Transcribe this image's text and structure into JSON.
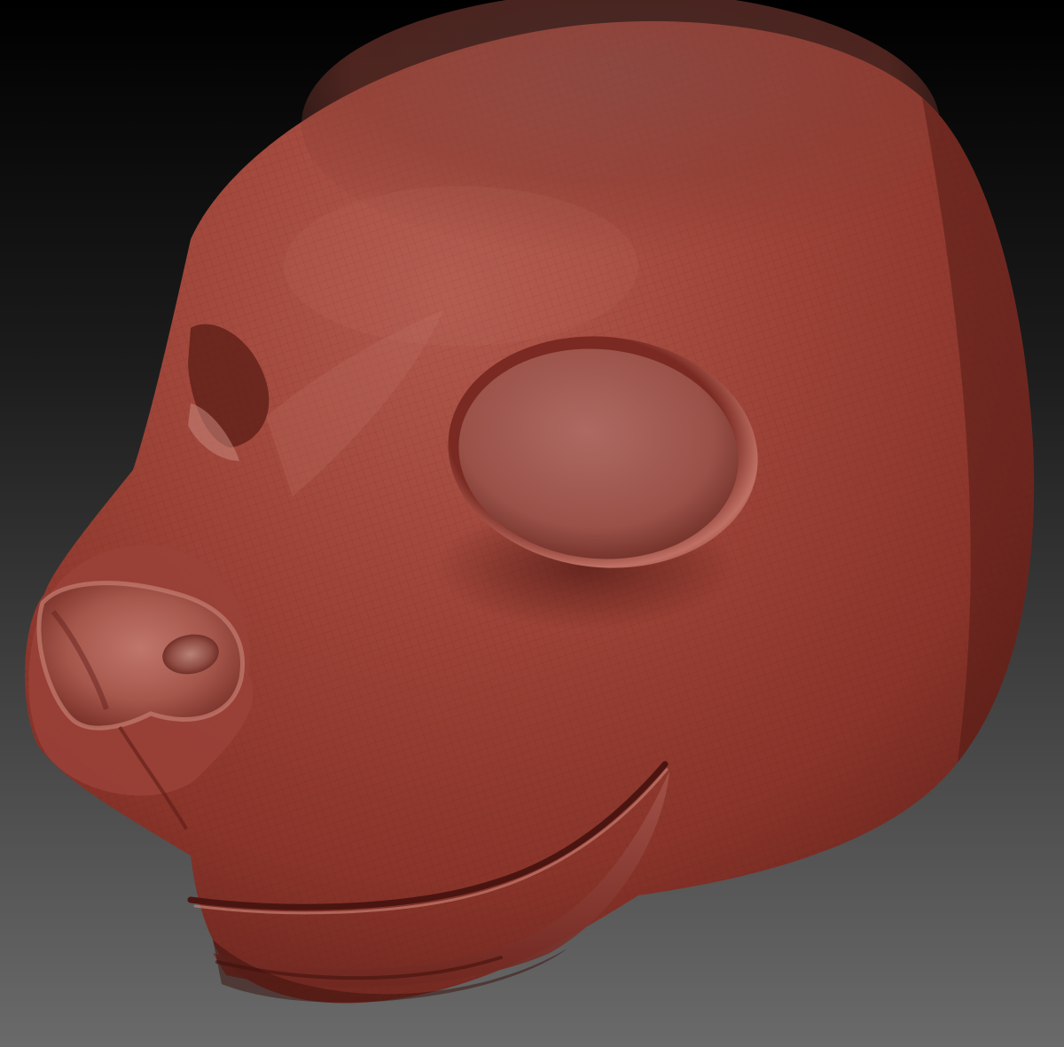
{
  "scene": {
    "subject": "sculpted-animal-head",
    "background": {
      "top_color": "#000000",
      "bottom_color": "#6a6a6a"
    },
    "material": {
      "base_color": "#9a3d33",
      "highlight_color": "#c46a5e",
      "shadow_color": "#4a1712"
    }
  }
}
